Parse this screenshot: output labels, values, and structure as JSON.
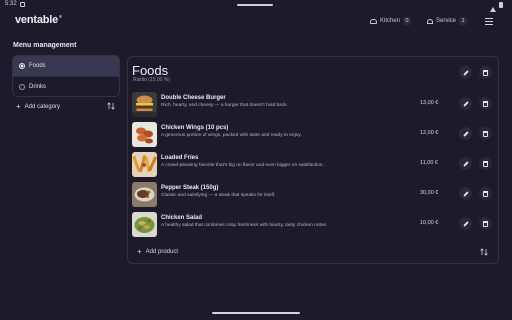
{
  "status": {
    "time": "5:32"
  },
  "header": {
    "logo": "ventable",
    "logo_mark": "®",
    "kitchen_label": "Kitchen",
    "kitchen_count": "0",
    "service_label": "Service",
    "service_count": "1"
  },
  "sidebar": {
    "title": "Menu management",
    "categories": [
      {
        "label": "Foods",
        "selected": true
      },
      {
        "label": "Drinks",
        "selected": false
      }
    ],
    "add_category_label": "Add category"
  },
  "main": {
    "title": "Foods",
    "subtitle": "Ristito (15,00 %)",
    "add_product_label": "Add product",
    "products": [
      {
        "name": "Double Cheese Burger",
        "description": "Rich, hearty, and cheesy — a burger that doesn't hold back.",
        "price": "13,00 €"
      },
      {
        "name": "Chicken Wings (10 pcs)",
        "description": "A generous portion of wings, packed with taste and ready to enjoy.",
        "price": "12,00 €"
      },
      {
        "name": "Loaded Fries",
        "description": "A crowd-pleasing favorite that's big on flavor and even bigger on satisfaction.",
        "price": "11,00 €"
      },
      {
        "name": "Pepper Steak (150g)",
        "description": "Classic and satisfying — a steak that speaks for itself.",
        "price": "30,00 €"
      },
      {
        "name": "Chicken Salad",
        "description": "A healthy salad that combines crisp freshness with hearty, tasty chicken notes.",
        "price": "10,00 €"
      }
    ]
  },
  "colors": {
    "background": "#1d1b2b",
    "panel_border": "#34324a",
    "selected_category": "#3a3850",
    "text_primary": "#eceaf5"
  }
}
